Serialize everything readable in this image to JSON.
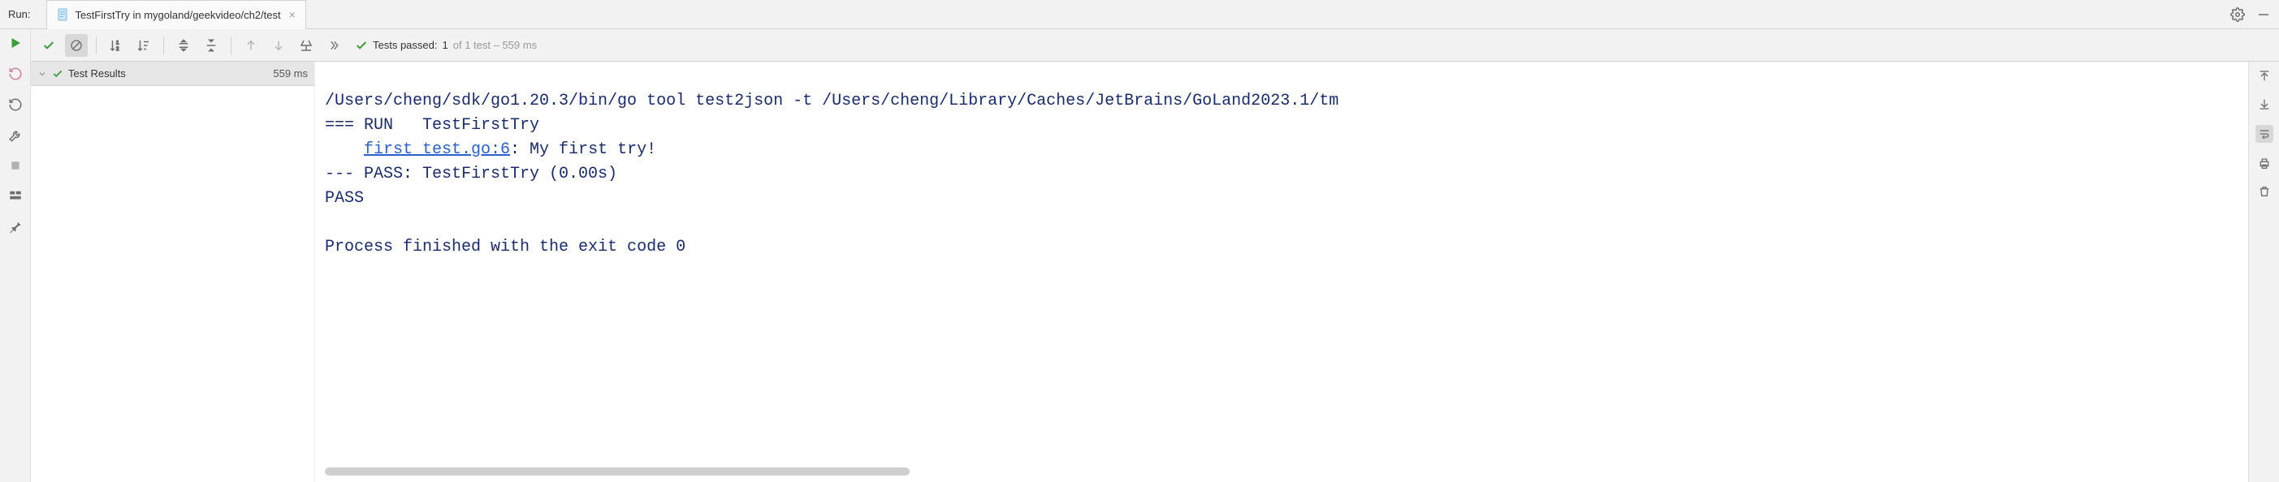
{
  "header": {
    "run_label": "Run:",
    "tab_title": "TestFirstTry in mygoland/geekvideo/ch2/test"
  },
  "toolbar": {
    "status_prefix": "Tests passed:",
    "passed_count": "1",
    "of_text": "of 1 test – 559 ms"
  },
  "tree": {
    "root_label": "Test Results",
    "root_time": "559 ms"
  },
  "console": {
    "line1": "/Users/cheng/sdk/go1.20.3/bin/go tool test2json -t /Users/cheng/Library/Caches/JetBrains/GoLand2023.1/tm",
    "line2": "=== RUN   TestFirstTry",
    "line3_indent": "    ",
    "line3_link": "first_test.go:6",
    "line3_rest": ": My first try!",
    "line4": "--- PASS: TestFirstTry (0.00s)",
    "line5": "PASS",
    "line6": "",
    "line7": "Process finished with the exit code 0"
  }
}
